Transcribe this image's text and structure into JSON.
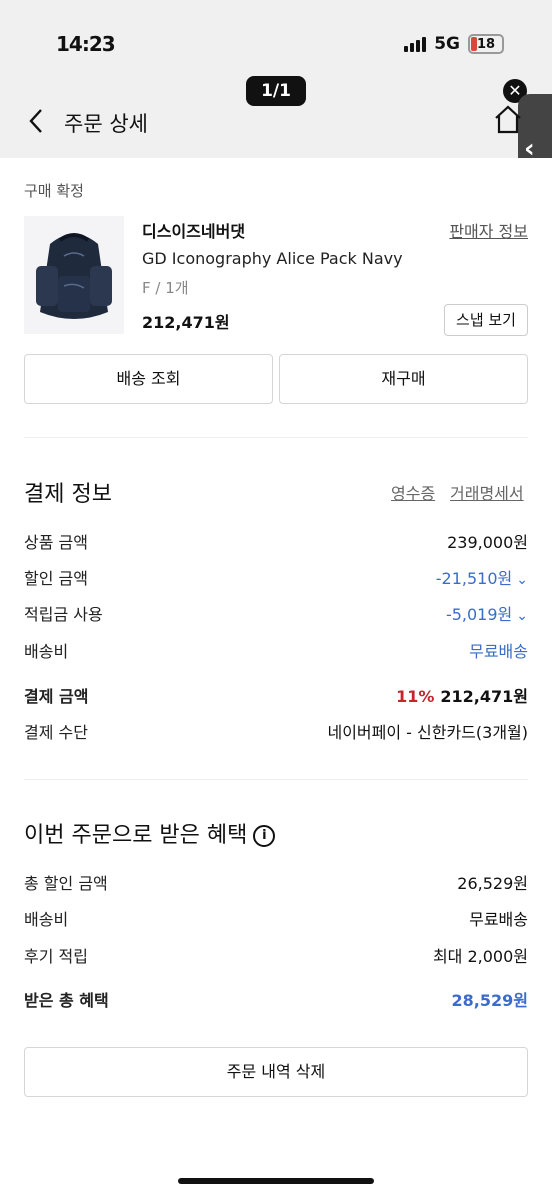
{
  "status_bar": {
    "time": "14:23",
    "network": "5G",
    "battery": "18"
  },
  "viewer": {
    "page_indicator": "1/1"
  },
  "header": {
    "title": "주문 상세"
  },
  "order": {
    "status": "구매 확정",
    "brand": "디스이즈네버댓",
    "seller_link": "판매자 정보",
    "product_name": "GD Iconography Alice Pack Navy",
    "option": "F / 1개",
    "price": "212,471원",
    "snap_button": "스냅 보기",
    "buttons": {
      "tracking": "배송 조회",
      "reorder": "재구매"
    }
  },
  "payment": {
    "title": "결제 정보",
    "receipt_link": "영수증",
    "statement_link": "거래명세서",
    "rows": [
      {
        "label": "상품 금액",
        "value": "239,000원"
      },
      {
        "label": "할인 금액",
        "value": "-21,510원"
      },
      {
        "label": "적립금 사용",
        "value": "-5,019원"
      },
      {
        "label": "배송비",
        "value": "무료배송"
      }
    ],
    "total": {
      "label": "결제 금액",
      "percent": "11%",
      "value": "212,471원"
    },
    "method": {
      "label": "결제 수단",
      "value": "네이버페이 - 신한카드(3개월)"
    }
  },
  "benefits": {
    "title": "이번 주문으로 받은 혜택",
    "rows": [
      {
        "label": "총 할인 금액",
        "value": "26,529원"
      },
      {
        "label": "배송비",
        "value": "무료배송"
      },
      {
        "label": "후기 적립",
        "value": "최대 2,000원"
      }
    ],
    "total": {
      "label": "받은 총 혜택",
      "value": "28,529원"
    }
  },
  "delete_button": "주문 내역 삭제",
  "colors": {
    "accent_blue": "#3a6cc8",
    "discount_red": "#c2272d",
    "header_gray": "#f0f0f0"
  },
  "icons": [
    "back-chevron-icon",
    "home-icon",
    "close-icon",
    "info-icon",
    "chevron-down-icon"
  ]
}
